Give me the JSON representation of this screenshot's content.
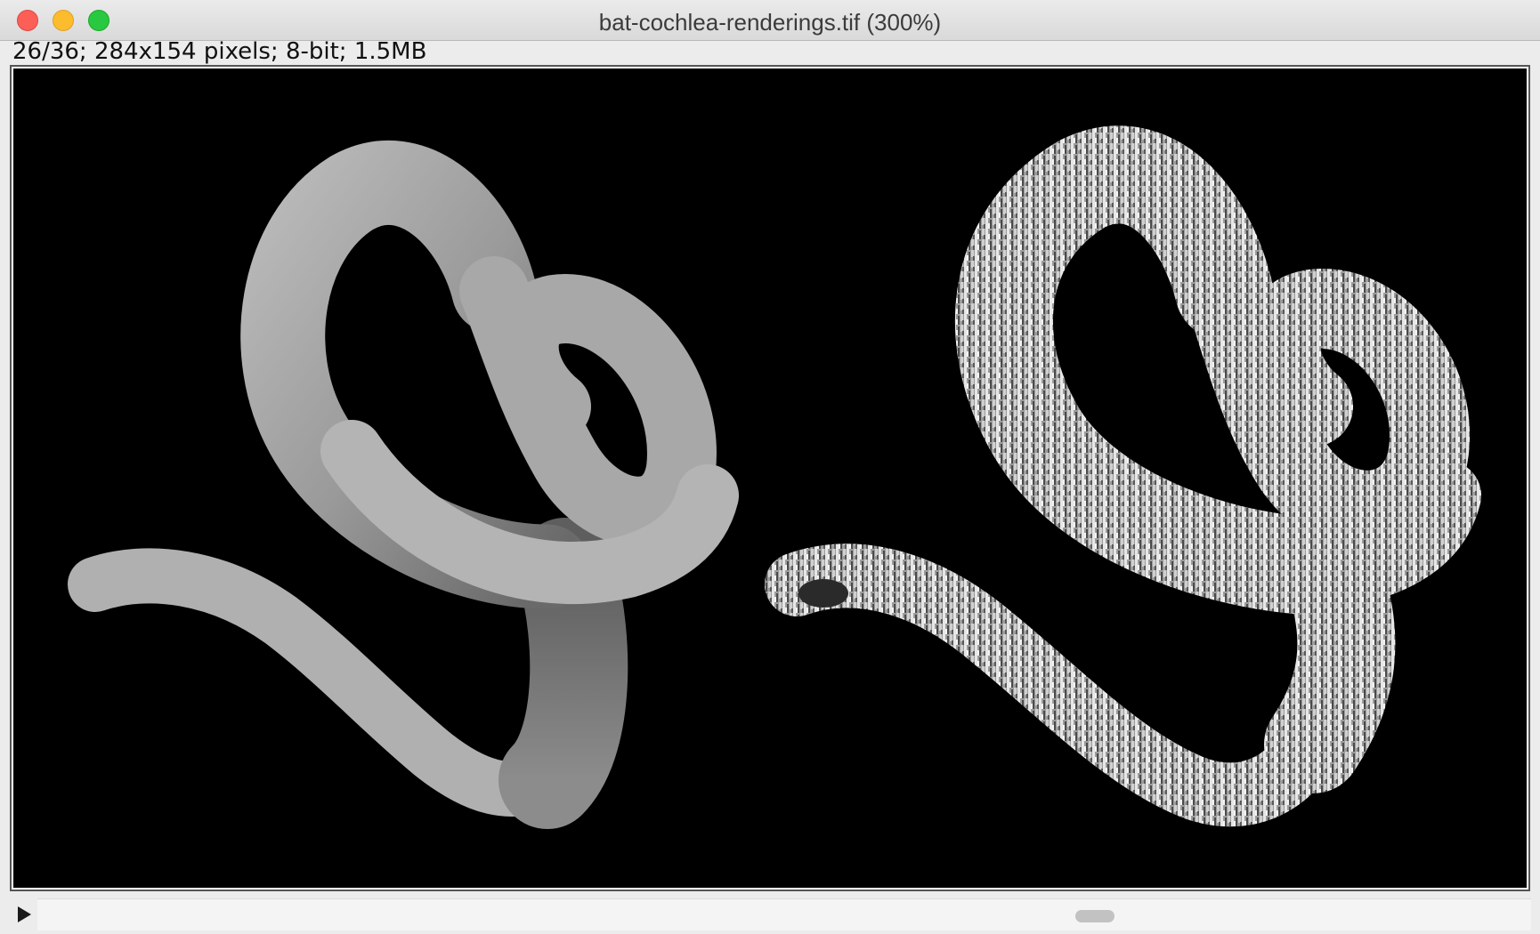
{
  "window": {
    "title": "bat-cochlea-renderings.tif (300%)",
    "info": "26/36; 284x154 pixels; 8-bit; 1.5MB"
  },
  "canvas": {
    "background_color": "#000000",
    "left_rendering": "depth-shaded cochlea rendering",
    "right_rendering": "surface-textured cochlea rendering"
  },
  "stack_slider": {
    "play_icon": "play-icon",
    "current_slice": 26,
    "total_slices": 36
  },
  "colors": {
    "close": "#fc5f57",
    "minimize": "#fdbc2e",
    "maximize": "#28c840"
  }
}
